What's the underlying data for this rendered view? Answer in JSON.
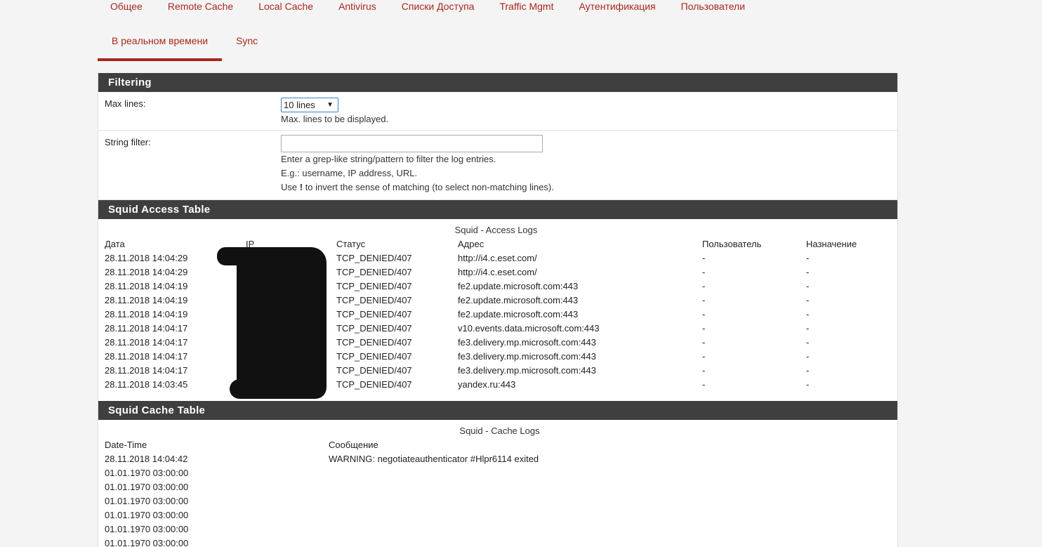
{
  "nav": {
    "row1": [
      "Общее",
      "Remote Cache",
      "Local Cache",
      "Antivirus",
      "Списки Доступа",
      "Traffic Mgmt",
      "Аутентификация",
      "Пользователи"
    ],
    "row2": [
      "В реальном времени",
      "Sync"
    ],
    "active_tab": "В реальном времени"
  },
  "filtering": {
    "heading": "Filtering",
    "max_lines_label": "Max lines:",
    "max_lines_value": "10 lines",
    "max_lines_help": "Max. lines to be displayed.",
    "string_filter_label": "String filter:",
    "string_filter_value": "",
    "string_filter_help1": "Enter a grep-like string/pattern to filter the log entries.",
    "string_filter_help2": "E.g.: username, IP address, URL.",
    "string_filter_help3_pre": "Use ",
    "string_filter_help3_bang": "!",
    "string_filter_help3_post": " to invert the sense of matching (to select non-matching lines)."
  },
  "access": {
    "heading": "Squid Access Table",
    "caption": "Squid - Access Logs",
    "columns": [
      "Дата",
      "IP",
      "Статус",
      "Адрес",
      "Пользователь",
      "Назначение"
    ],
    "rows": [
      [
        "28.11.2018 14:04:29",
        "",
        "TCP_DENIED/407",
        "http://i4.c.eset.com/",
        "-",
        "-"
      ],
      [
        "28.11.2018 14:04:29",
        "",
        "TCP_DENIED/407",
        "http://i4.c.eset.com/",
        "-",
        "-"
      ],
      [
        "28.11.2018 14:04:19",
        "",
        "TCP_DENIED/407",
        "fe2.update.microsoft.com:443",
        "-",
        "-"
      ],
      [
        "28.11.2018 14:04:19",
        "",
        "TCP_DENIED/407",
        "fe2.update.microsoft.com:443",
        "-",
        "-"
      ],
      [
        "28.11.2018 14:04:19",
        "",
        "TCP_DENIED/407",
        "fe2.update.microsoft.com:443",
        "-",
        "-"
      ],
      [
        "28.11.2018 14:04:17",
        "",
        "TCP_DENIED/407",
        "v10.events.data.microsoft.com:443",
        "-",
        "-"
      ],
      [
        "28.11.2018 14:04:17",
        "",
        "TCP_DENIED/407",
        "fe3.delivery.mp.microsoft.com:443",
        "-",
        "-"
      ],
      [
        "28.11.2018 14:04:17",
        "",
        "TCP_DENIED/407",
        "fe3.delivery.mp.microsoft.com:443",
        "-",
        "-"
      ],
      [
        "28.11.2018 14:04:17",
        "",
        "TCP_DENIED/407",
        "fe3.delivery.mp.microsoft.com:443",
        "-",
        "-"
      ],
      [
        "28.11.2018 14:03:45",
        "",
        "TCP_DENIED/407",
        "yandex.ru:443",
        "-",
        "-"
      ]
    ]
  },
  "cache": {
    "heading": "Squid Cache Table",
    "caption": "Squid - Cache Logs",
    "columns": [
      "Date-Time",
      "Сообщение"
    ],
    "rows": [
      [
        "28.11.2018 14:04:42",
        "WARNING: negotiateauthenticator #Hlpr6114 exited"
      ],
      [
        "01.01.1970 03:00:00",
        ""
      ],
      [
        "01.01.1970 03:00:00",
        ""
      ],
      [
        "01.01.1970 03:00:00",
        ""
      ],
      [
        "01.01.1970 03:00:00",
        ""
      ],
      [
        "01.01.1970 03:00:00",
        ""
      ],
      [
        "01.01.1970 03:00:00",
        ""
      ]
    ]
  }
}
